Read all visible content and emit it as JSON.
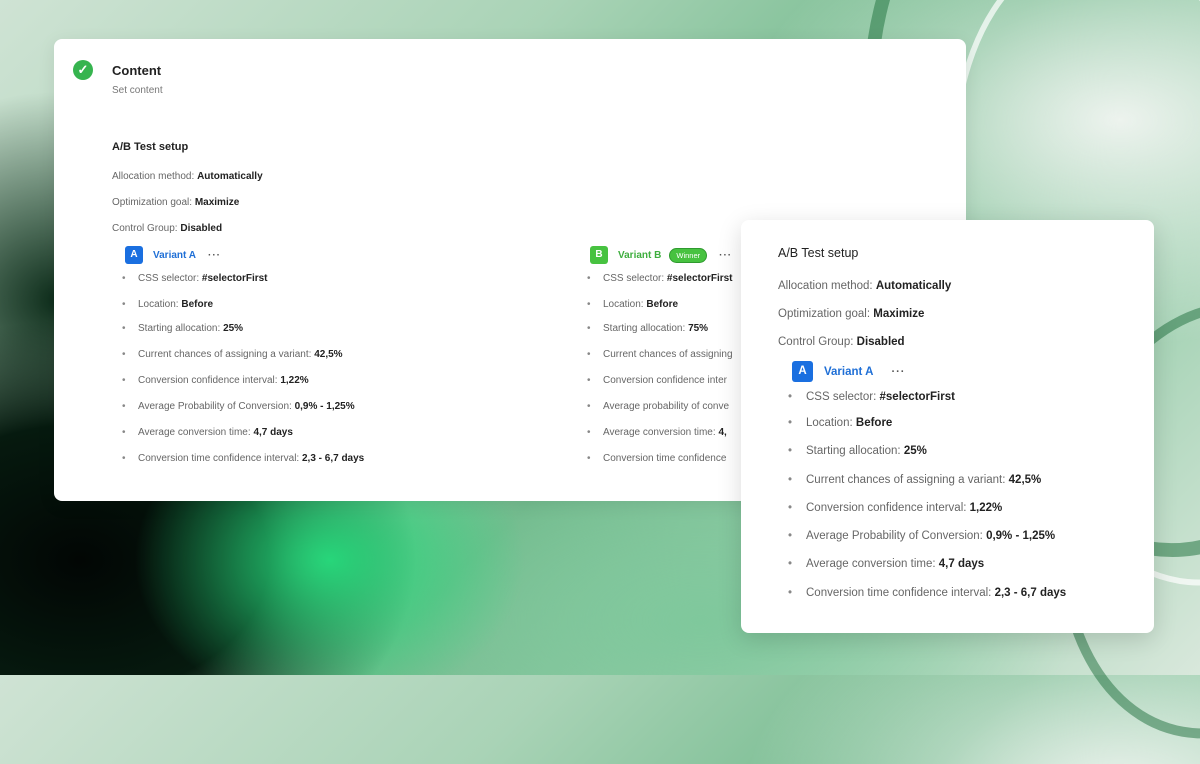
{
  "step": {
    "title": "Content",
    "subtitle": "Set content",
    "status_icon": "checkmark-icon"
  },
  "setup": {
    "title": "A/B Test setup",
    "allocation": {
      "label": "Allocation method:",
      "value": "Automatically"
    },
    "goal": {
      "label": "Optimization goal:",
      "value": "Maximize"
    },
    "control": {
      "label": "Control Group:",
      "value": "Disabled"
    }
  },
  "variant_a": {
    "badge": "A",
    "name": "Variant A",
    "menu": "···",
    "color": "#1a6fe0",
    "items": [
      {
        "label": "CSS selector:",
        "value": "#selectorFirst"
      },
      {
        "label": "Location:",
        "value": "Before"
      },
      {
        "label": "Starting allocation:",
        "value": "25%"
      },
      {
        "label": "Current chances of assigning a variant:",
        "value": "42,5%"
      },
      {
        "label": "Conversion confidence interval:",
        "value": "1,22%"
      },
      {
        "label": "Average Probability of Conversion:",
        "value": "0,9% - 1,25%"
      },
      {
        "label": "Average conversion time:",
        "value": "4,7 days"
      },
      {
        "label": "Conversion time confidence interval:",
        "value": "2,3 - 6,7 days"
      }
    ]
  },
  "variant_b": {
    "badge": "B",
    "name": "Variant B",
    "winner": "Winner",
    "menu": "···",
    "color": "#47c240",
    "items": [
      {
        "label": "CSS selector:",
        "value": "#selectorFirst"
      },
      {
        "label": "Location:",
        "value": "Before"
      },
      {
        "label": "Starting allocation:",
        "value": "75%"
      },
      {
        "label": "Current chances of assigning",
        "value": ""
      },
      {
        "label": "Conversion confidence inter",
        "value": ""
      },
      {
        "label": "Average probability of conve",
        "value": ""
      },
      {
        "label": "Average conversion time:",
        "value": "4,"
      },
      {
        "label": "Conversion time confidence",
        "value": ""
      }
    ]
  }
}
